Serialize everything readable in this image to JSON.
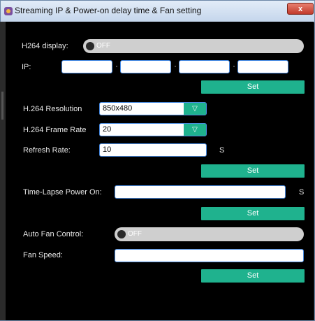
{
  "window": {
    "title": "Streaming IP & Power-on delay time & Fan setting",
    "close_label": "x"
  },
  "h264_display": {
    "label": "H264 display:",
    "state": "OFF"
  },
  "ip": {
    "label": "IP:",
    "octets": [
      "",
      "",
      "",
      ""
    ],
    "separator": "·"
  },
  "set_button_label": "Set",
  "h264_resolution": {
    "label": "H.264 Resolution",
    "value": "850x480",
    "arrow": "▽"
  },
  "h264_frame_rate": {
    "label": "H.264 Frame Rate",
    "value": "20",
    "arrow": "▽"
  },
  "refresh_rate": {
    "label": "Refresh Rate:",
    "value": "10",
    "unit": "S"
  },
  "time_lapse": {
    "label": "Time-Lapse Power On:",
    "value": "",
    "unit": "S"
  },
  "auto_fan": {
    "label": "Auto Fan Control:",
    "state": "OFF"
  },
  "fan_speed": {
    "label": "Fan Speed:",
    "value": ""
  },
  "colors": {
    "accent": "#1fb28e",
    "background": "#000000",
    "toggle_bg": "#cfcfcf",
    "input_border": "#4a8be0"
  }
}
